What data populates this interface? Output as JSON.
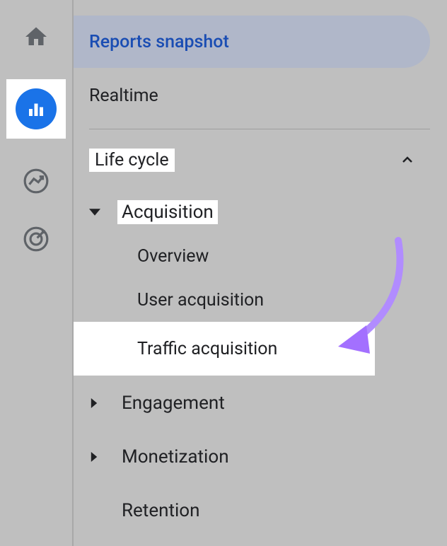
{
  "nav": {
    "reports_snapshot": "Reports snapshot",
    "realtime": "Realtime"
  },
  "section": {
    "life_cycle": "Life cycle"
  },
  "groups": {
    "acquisition": {
      "label": "Acquisition",
      "items": {
        "overview": "Overview",
        "user_acquisition": "User acquisition",
        "traffic_acquisition": "Traffic acquisition"
      }
    },
    "engagement": "Engagement",
    "monetization": "Monetization",
    "retention": "Retention"
  }
}
